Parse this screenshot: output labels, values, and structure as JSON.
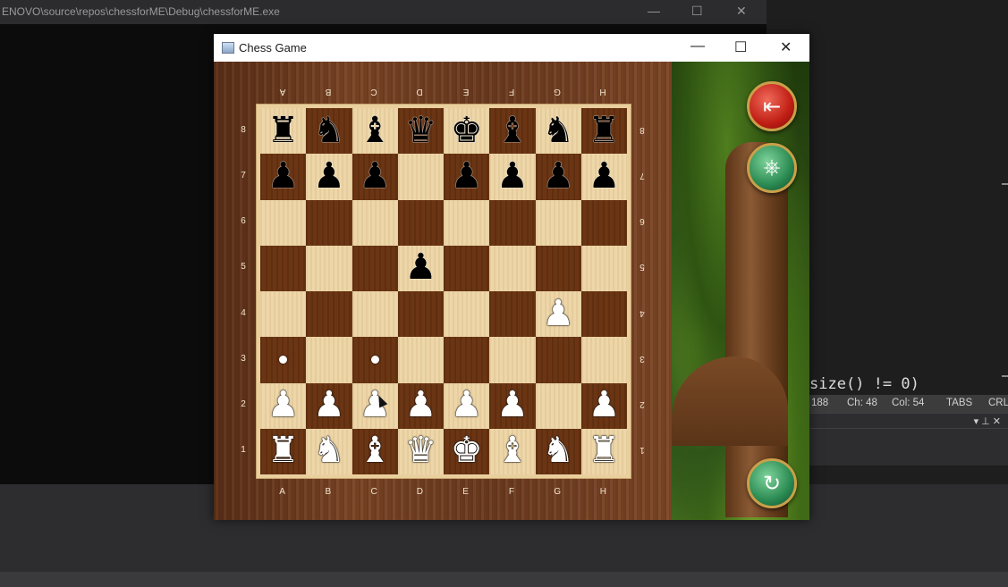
{
  "console": {
    "title": "ENOVO\\source\\repos\\chessforME\\Debug\\chessforME.exe",
    "minimize_symbol": "—",
    "maximize_symbol": "☐",
    "close_symbol": "✕"
  },
  "ide": {
    "code_fragment": "size() != 0)",
    "status": {
      "line": "188",
      "ch": "Ch: 48",
      "col": "Col: 54",
      "tabs": "TABS",
      "eol": "CRL"
    },
    "panel_icons": "▾ ⊥ ✕"
  },
  "window": {
    "title": "Chess Game",
    "minimize_symbol": "—",
    "maximize_symbol": "☐",
    "close_symbol": "✕"
  },
  "board": {
    "files": [
      "A",
      "B",
      "C",
      "D",
      "E",
      "F",
      "G",
      "H"
    ],
    "ranks": [
      "8",
      "7",
      "6",
      "5",
      "4",
      "3",
      "2",
      "1"
    ],
    "squares": [
      [
        "♜b",
        "♞b",
        "♝b",
        "♛b",
        "♚b",
        "♝b",
        "♞b",
        "♜b"
      ],
      [
        "♟b",
        "♟b",
        "♟b",
        "",
        "♟b",
        "♟b",
        "♟b",
        "♟b"
      ],
      [
        "",
        "",
        "",
        "",
        "",
        "",
        "",
        ""
      ],
      [
        "",
        "",
        "",
        "♟b",
        "",
        "",
        "",
        ""
      ],
      [
        "",
        "",
        "",
        "",
        "",
        "",
        "♟w",
        ""
      ],
      [
        "•",
        "",
        "•",
        "",
        "",
        "",
        "",
        ""
      ],
      [
        "♟w",
        "♟w",
        "♟w",
        "♟w",
        "♟w",
        "♟w",
        "",
        "♟w"
      ],
      [
        "♜w",
        "♞w",
        "♝w",
        "♛w",
        "♚w",
        "♝w",
        "♞w",
        "♜w"
      ]
    ]
  },
  "side_buttons": {
    "exit_icon": "exit-door-icon",
    "settings_icon": "ship-wheel-icon",
    "restart_icon": "restart-icon",
    "exit_glyph": "⇤",
    "settings_glyph": "⎈",
    "restart_glyph": "↻"
  },
  "colors": {
    "light_square": "#edd6a8",
    "dark_square": "#6b3513",
    "exit_button": "#c01e14",
    "green_button": "#2a8a52"
  }
}
